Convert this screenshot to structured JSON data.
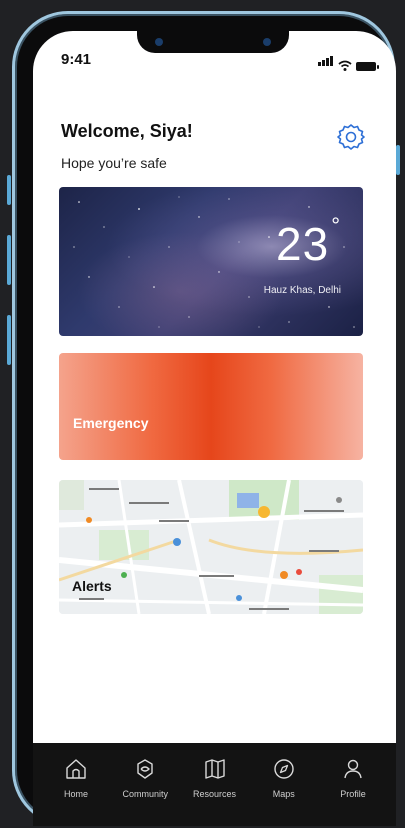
{
  "status": {
    "time": "9:41"
  },
  "header": {
    "welcome": "Welcome, Siya!",
    "subtitle": "Hope you’re safe",
    "settings_icon": "settings-gear-icon"
  },
  "weather": {
    "temperature": "23",
    "unit": "°",
    "location": "Hauz Khas, Delhi"
  },
  "emergency": {
    "label": "Emergency"
  },
  "map": {
    "label": "Alerts"
  },
  "tabbar": {
    "items": [
      {
        "label": "Home",
        "icon": "home-icon"
      },
      {
        "label": "Community",
        "icon": "community-icon"
      },
      {
        "label": "Resources",
        "icon": "map-book-icon"
      },
      {
        "label": "Maps",
        "icon": "compass-icon"
      },
      {
        "label": "Profile",
        "icon": "profile-icon"
      }
    ]
  },
  "colors": {
    "accent": "#2d6fd6",
    "emergency": "#e6461b",
    "frame": "#9fc7df",
    "tabbar": "#131313"
  }
}
